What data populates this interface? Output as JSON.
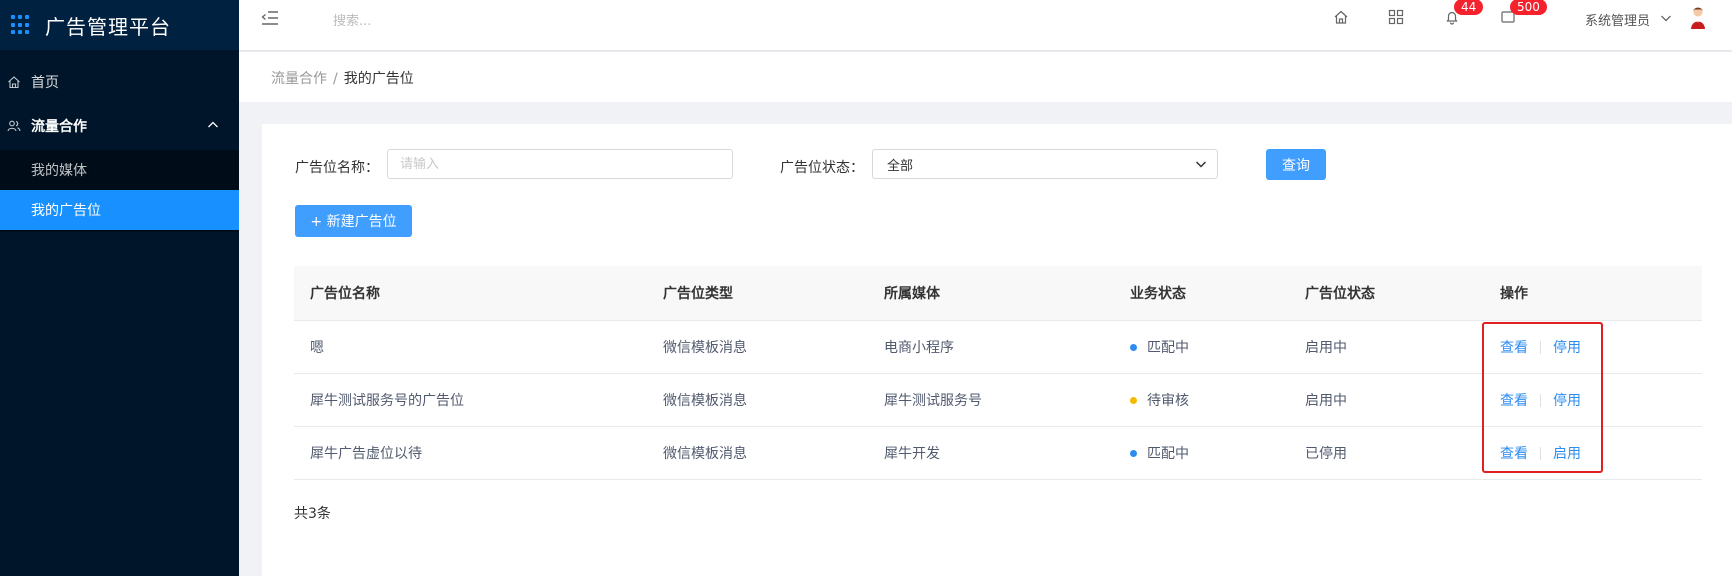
{
  "app": {
    "title": "广告管理平台"
  },
  "sidebar": {
    "home": "首页",
    "group": "流量合作",
    "items": [
      "我的媒体",
      "我的广告位"
    ]
  },
  "header": {
    "search_placeholder": "搜索...",
    "notifications_count": "44",
    "messages_count": "500",
    "user": "系统管理员"
  },
  "breadcrumb": {
    "parent": "流量合作",
    "separator": "/",
    "current": "我的广告位"
  },
  "filters": {
    "name_label": "广告位名称：",
    "name_placeholder": "请输入",
    "status_label": "广告位状态：",
    "status_value": "全部",
    "query_button": "查询"
  },
  "new_button": "+ 新建广告位",
  "table": {
    "headers": [
      "广告位名称",
      "广告位类型",
      "所属媒体",
      "业务状态",
      "广告位状态",
      "操作"
    ],
    "rows": [
      {
        "name": "嗯",
        "type": "微信模板消息",
        "media": "电商小程序",
        "biz_status": "匹配中",
        "biz_color": "#2d8cf0",
        "status": "启用中",
        "action_view": "查看",
        "action_toggle": "停用"
      },
      {
        "name": "犀牛测试服务号的广告位",
        "type": "微信模板消息",
        "media": "犀牛测试服务号",
        "biz_status": "待审核",
        "biz_color": "#f5b800",
        "status": "启用中",
        "action_view": "查看",
        "action_toggle": "停用"
      },
      {
        "name": "犀牛广告虚位以待",
        "type": "微信模板消息",
        "media": "犀牛开发",
        "biz_status": "匹配中",
        "biz_color": "#2d8cf0",
        "status": "已停用",
        "action_view": "查看",
        "action_toggle": "启用"
      }
    ]
  },
  "total_text": "共3条",
  "colors": {
    "accent": "#1890ff",
    "sidebar_bg": "#001529",
    "highlight": "#e02020"
  }
}
